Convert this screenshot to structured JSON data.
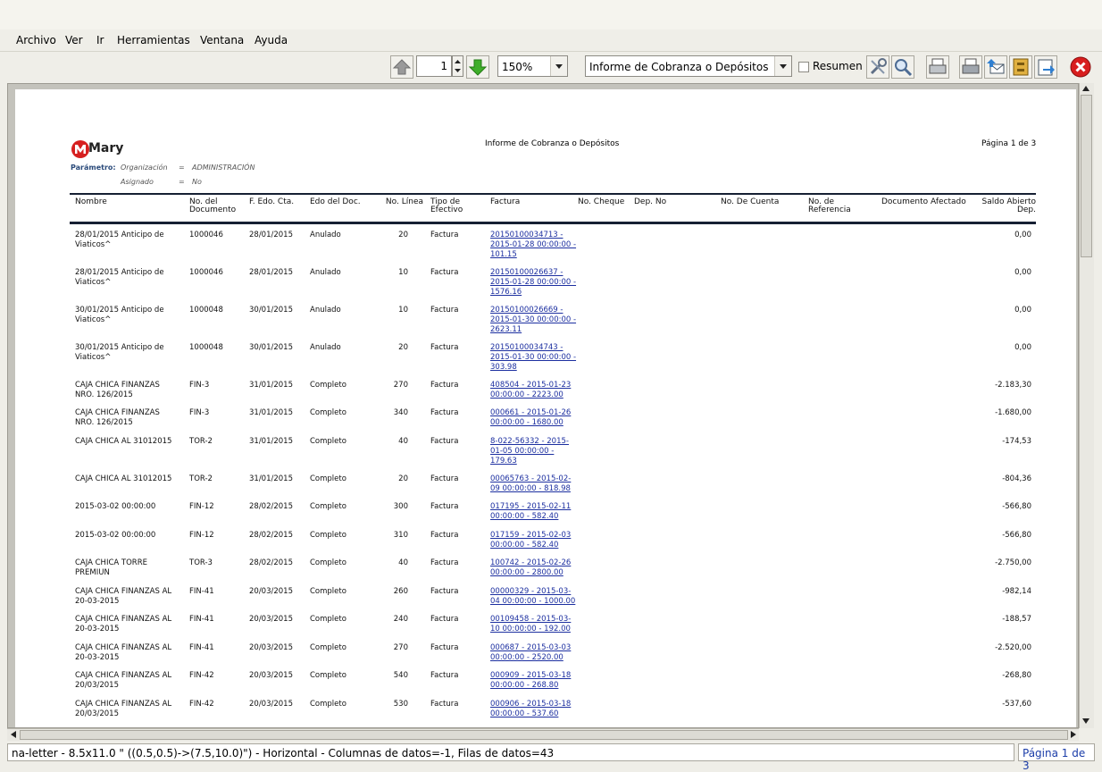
{
  "menu": {
    "archivo": "Archivo",
    "ver": "Ver",
    "ir": "Ir",
    "herramientas": "Herramientas",
    "ventana": "Ventana",
    "ayuda": "Ayuda"
  },
  "toolbar": {
    "page_value": "1",
    "zoom": "150%",
    "report_select": "Informe de Cobranza o Depósitos",
    "resumen_label": "Resumen"
  },
  "report": {
    "logo_text": "Mary",
    "title": "Informe de Cobranza o Depósitos",
    "page": "Página 1 de 3",
    "param_label": "Parámetro:",
    "param1_name": "Organización",
    "param1_eq": "=",
    "param1_value": "ADMINISTRACIÓN",
    "param2_name": "Asignado",
    "param2_eq": "=",
    "param2_value": "No",
    "headers": [
      "Nombre",
      "No. del\nDocumento",
      "F. Edo. Cta.",
      "Edo del Doc.",
      "No. Línea",
      "Tipo de\nEfectivo",
      "Factura",
      "No. Cheque",
      "Dep. No",
      "No. De Cuenta",
      "No. de\nReferencia",
      "Documento Afectado",
      "Saldo Abierto\nDep."
    ],
    "rows": [
      {
        "nombre": "28/01/2015 Anticipo de\nViaticos^",
        "doc": "1000046",
        "fecha": "28/01/2015",
        "estado": "Anulado",
        "linea": "20",
        "tipo": "Factura",
        "factura": "20150100034713 -\n2015-01-28 00:00:00 -\n101.15",
        "saldo": "0,00"
      },
      {
        "nombre": "28/01/2015 Anticipo de\nViaticos^",
        "doc": "1000046",
        "fecha": "28/01/2015",
        "estado": "Anulado",
        "linea": "10",
        "tipo": "Factura",
        "factura": "20150100026637 -\n2015-01-28 00:00:00 -\n1576.16",
        "saldo": "0,00"
      },
      {
        "nombre": "30/01/2015 Anticipo de\nViaticos^",
        "doc": "1000048",
        "fecha": "30/01/2015",
        "estado": "Anulado",
        "linea": "10",
        "tipo": "Factura",
        "factura": "20150100026669 -\n2015-01-30 00:00:00 -\n2623.11",
        "saldo": "0,00"
      },
      {
        "nombre": "30/01/2015 Anticipo de\nViaticos^",
        "doc": "1000048",
        "fecha": "30/01/2015",
        "estado": "Anulado",
        "linea": "20",
        "tipo": "Factura",
        "factura": "20150100034743 -\n2015-01-30 00:00:00 -\n303.98",
        "saldo": "0,00"
      },
      {
        "nombre": "CAJA CHICA FINANZAS\nNRO. 126/2015",
        "doc": "FIN-3",
        "fecha": "31/01/2015",
        "estado": "Completo",
        "linea": "270",
        "tipo": "Factura",
        "factura": "408504 - 2015-01-23\n00:00:00 - 2223.00",
        "saldo": "-2.183,30"
      },
      {
        "nombre": "CAJA CHICA FINANZAS\nNRO. 126/2015",
        "doc": "FIN-3",
        "fecha": "31/01/2015",
        "estado": "Completo",
        "linea": "340",
        "tipo": "Factura",
        "factura": "000661 - 2015-01-26\n00:00:00 - 1680.00",
        "saldo": "-1.680,00"
      },
      {
        "nombre": "CAJA CHICA AL 31012015",
        "doc": "TOR-2",
        "fecha": "31/01/2015",
        "estado": "Completo",
        "linea": "40",
        "tipo": "Factura",
        "factura": "8-022-56332 - 2015-\n01-05 00:00:00 -\n179.63",
        "saldo": "-174,53"
      },
      {
        "nombre": "CAJA CHICA AL 31012015",
        "doc": "TOR-2",
        "fecha": "31/01/2015",
        "estado": "Completo",
        "linea": "20",
        "tipo": "Factura",
        "factura": "00065763 - 2015-02-\n09 00:00:00 - 818.98",
        "saldo": "-804,36"
      },
      {
        "nombre": "2015-03-02 00:00:00",
        "doc": "FIN-12",
        "fecha": "28/02/2015",
        "estado": "Completo",
        "linea": "300",
        "tipo": "Factura",
        "factura": "017195  - 2015-02-11\n00:00:00 - 582.40",
        "saldo": "-566,80"
      },
      {
        "nombre": "2015-03-02 00:00:00",
        "doc": "FIN-12",
        "fecha": "28/02/2015",
        "estado": "Completo",
        "linea": "310",
        "tipo": "Factura",
        "factura": "017159 - 2015-02-03\n00:00:00 - 582.40",
        "saldo": "-566,80"
      },
      {
        "nombre": "CAJA CHICA TORRE\nPREMIUN",
        "doc": "TOR-3",
        "fecha": "28/02/2015",
        "estado": "Completo",
        "linea": "40",
        "tipo": "Factura",
        "factura": "100742 - 2015-02-26\n00:00:00 - 2800.00",
        "saldo": "-2.750,00"
      },
      {
        "nombre": "CAJA CHICA FINANZAS AL\n20-03-2015",
        "doc": "FIN-41",
        "fecha": "20/03/2015",
        "estado": "Completo",
        "linea": "260",
        "tipo": "Factura",
        "factura": "00000329 - 2015-03-\n04 00:00:00 - 1000.00",
        "saldo": "-982,14"
      },
      {
        "nombre": "CAJA CHICA FINANZAS AL\n20-03-2015",
        "doc": "FIN-41",
        "fecha": "20/03/2015",
        "estado": "Completo",
        "linea": "240",
        "tipo": "Factura",
        "factura": "00109458 - 2015-03-\n10 00:00:00 - 192.00",
        "saldo": "-188,57"
      },
      {
        "nombre": "CAJA CHICA FINANZAS AL\n20-03-2015",
        "doc": "FIN-41",
        "fecha": "20/03/2015",
        "estado": "Completo",
        "linea": "270",
        "tipo": "Factura",
        "factura": "000687 - 2015-03-03\n00:00:00 - 2520.00",
        "saldo": "-2.520,00"
      },
      {
        "nombre": "CAJA CHICA FINANZAS AL\n20/03/2015",
        "doc": "FIN-42",
        "fecha": "20/03/2015",
        "estado": "Completo",
        "linea": "540",
        "tipo": "Factura",
        "factura": "000909 - 2015-03-18\n00:00:00 - 268.80",
        "saldo": "-268,80"
      },
      {
        "nombre": "CAJA CHICA FINANZAS AL\n20/03/2015",
        "doc": "FIN-42",
        "fecha": "20/03/2015",
        "estado": "Completo",
        "linea": "530",
        "tipo": "Factura",
        "factura": "000906  - 2015-03-18\n00:00:00 - 537.60",
        "saldo": "-537,60"
      }
    ]
  },
  "status": {
    "left": "na-letter - 8.5x11.0 \" ((0.5,0.5)->(7.5,10.0)\") - Horizontal - Columnas de datos=-1, Filas de datos=43",
    "right": "Página 1 de 3"
  }
}
